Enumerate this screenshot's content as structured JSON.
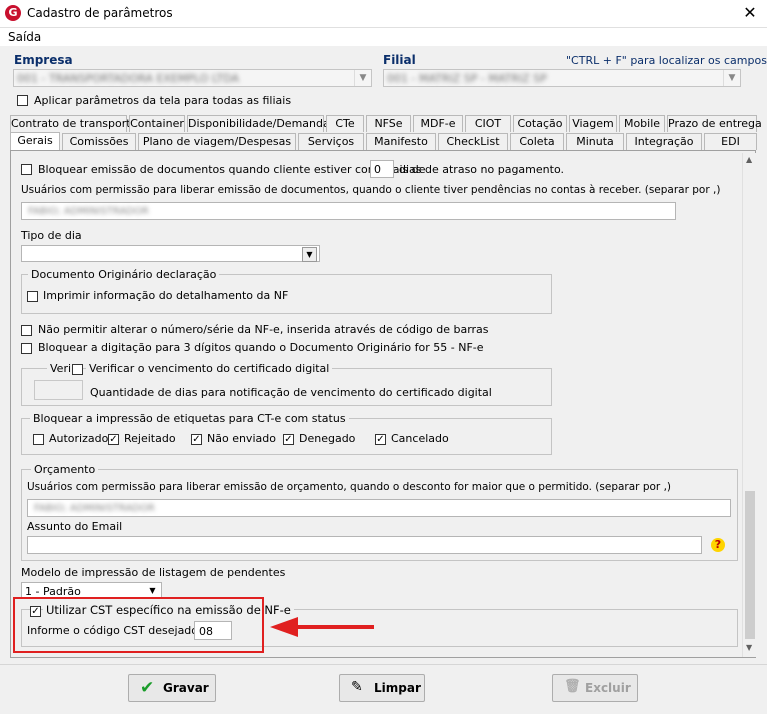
{
  "window": {
    "title": "Cadastro de parâmetros",
    "close": "✕"
  },
  "menu": {
    "saida": "Saída"
  },
  "empresa": {
    "label": "Empresa",
    "value": "001 - TRANSPORTADORA EXEMPLO LTDA"
  },
  "filial": {
    "label": "Filial",
    "value": "001 - MATRIZ SP - MATRIZ SP"
  },
  "hint": "\"CTRL + F\" para localizar os campos",
  "apply_all": "Aplicar parâmetros da tela para todas as filiais",
  "tabs_row1": [
    "Contrato de transporte",
    "Container",
    "Disponibilidade/Demanda",
    "CTe",
    "NFSe",
    "MDF-e",
    "CIOT",
    "Cotação",
    "Viagem",
    "Mobile",
    "Prazo de entrega"
  ],
  "tabs_row2": [
    "Gerais",
    "Comissões",
    "Plano de viagem/Despesas",
    "Serviços",
    "Manifesto",
    "CheckList",
    "Coleta",
    "Minuta",
    "Integração",
    "EDI"
  ],
  "content": {
    "bloquear_prefix": "Bloquear emissão de documentos quando cliente estiver com mais de",
    "bloquear_days": "0",
    "bloquear_suffix": "dias de atraso no pagamento.",
    "usuarios_liberar": "Usuários com permissão para liberar emissão de documentos, quando o cliente tiver pendências no contas à receber. (separar por ,)",
    "usuarios_value": "FABIO; ADMINISTRADOR",
    "tipo_dia": "Tipo de dia",
    "doc_orig_title": "Documento Originário declaração",
    "imprimir_info": "Imprimir informação do detalhamento da NF",
    "nao_permitir": "Não permitir alterar o número/série da NF-e, inserida através de código de barras",
    "bloquear_digitacao": "Bloquear a digitação para 3 dígitos quando o Documento Originário for 55 - NF-e",
    "veri_label": "Veri",
    "verificar_venc": "Verificar o vencimento do certificado digital",
    "qtd_dias": "Quantidade de dias para notificação de vencimento do certificado digital",
    "etiquetas_title": "Bloquear a impressão de etiquetas para CT-e com status",
    "status": [
      {
        "label": "Autorizado",
        "checked": false
      },
      {
        "label": "Rejeitado",
        "checked": true
      },
      {
        "label": "Não enviado",
        "checked": true
      },
      {
        "label": "Denegado",
        "checked": true
      },
      {
        "label": "Cancelado",
        "checked": true
      }
    ],
    "orcamento_title": "Orçamento",
    "orc_usuarios": "Usuários com permissão para liberar emissão de orçamento, quando o desconto for maior que o permitido. (separar por ,)",
    "orc_value": "FABIO; ADMINISTRADOR",
    "assunto_email": "Assunto do Email",
    "modelo_label": "Modelo de impressão de listagem de pendentes",
    "modelo_value": "1 - Padrão",
    "cst_check": "Utilizar CST específico na emissão de NF-e",
    "cst_label": "Informe o código CST desejado:",
    "cst_value": "08"
  },
  "buttons": {
    "gravar": "Gravar",
    "limpar": "Limpar",
    "excluir": "Excluir"
  },
  "colors": {
    "accent": "#0b2f6b",
    "red": "#e02020",
    "check_green": "#1a9c2a"
  }
}
